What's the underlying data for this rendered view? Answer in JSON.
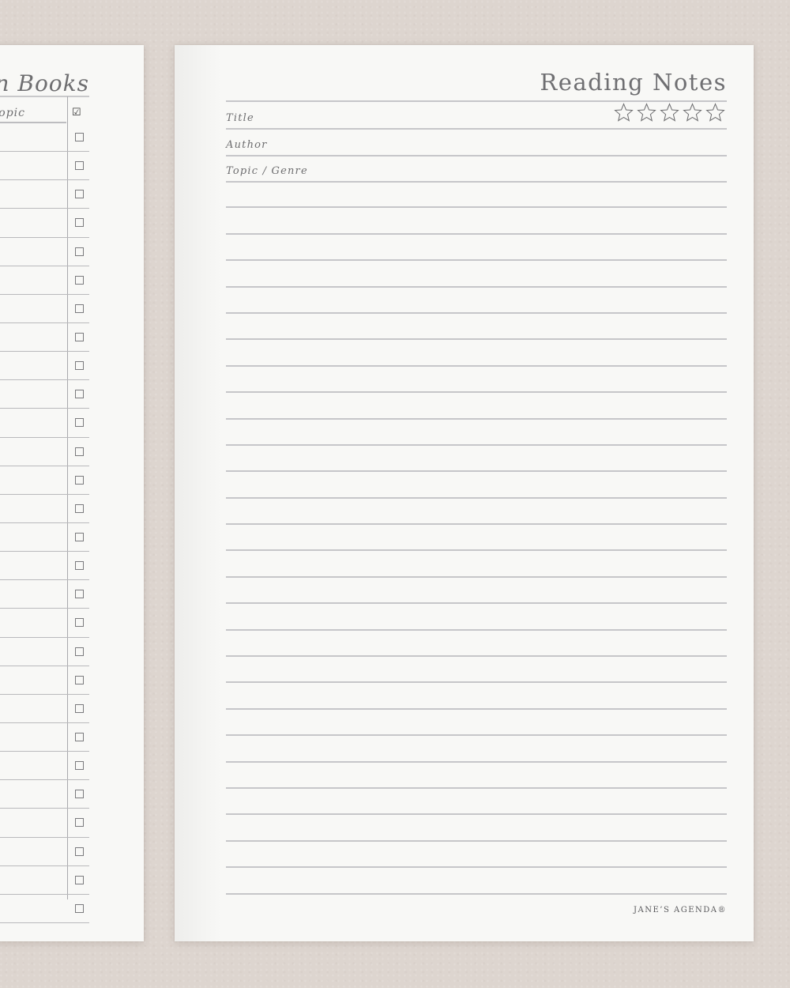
{
  "left_page": {
    "title": "n Books",
    "column_label": "opic",
    "check_header": "☑",
    "row_count": 28
  },
  "right_page": {
    "title": "Reading Notes",
    "rating_icons": [
      "star-outline-icon",
      "star-outline-icon",
      "star-outline-icon",
      "star-outline-icon",
      "star-outline-icon"
    ],
    "fields": [
      {
        "label": "Title"
      },
      {
        "label": "Author"
      },
      {
        "label": "Topic / Genre"
      }
    ],
    "note_line_count": 27,
    "brand": "JANE’S AGENDA®"
  },
  "colors": {
    "background": "#ddd5cf",
    "paper": "#f8f8f6",
    "text": "#6e6e70",
    "rule": "#c6c6c9"
  }
}
